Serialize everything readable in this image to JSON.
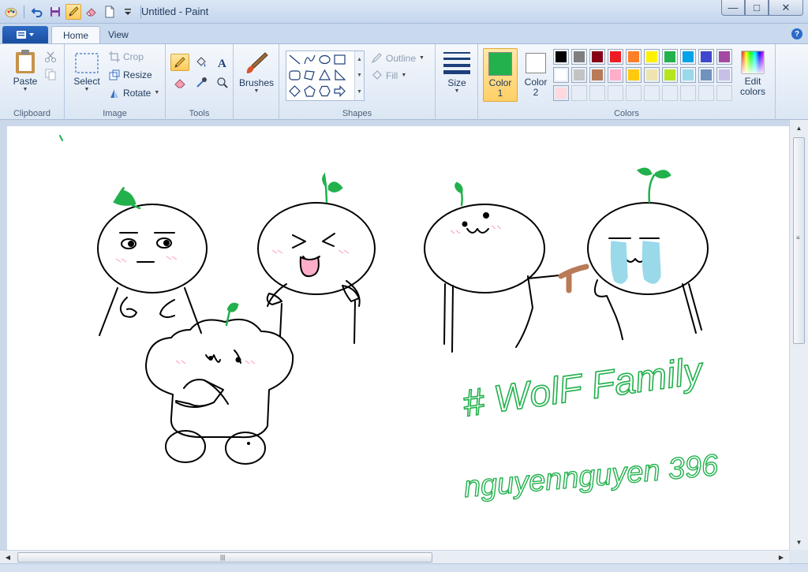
{
  "window": {
    "title": "Untitled - Paint",
    "controls": {
      "minimize": "—",
      "maximize": "□",
      "close": "✕"
    }
  },
  "tabs": [
    {
      "label": "Home",
      "active": true
    },
    {
      "label": "View",
      "active": false
    }
  ],
  "help": "?",
  "ribbon": {
    "clipboard": {
      "group_label": "Clipboard",
      "paste": "Paste"
    },
    "image": {
      "group_label": "Image",
      "select": "Select",
      "crop": "Crop",
      "resize": "Resize",
      "rotate": "Rotate"
    },
    "tools": {
      "group_label": "Tools",
      "active_tool": "pencil"
    },
    "brushes": {
      "label": "Brushes"
    },
    "shapes": {
      "group_label": "Shapes",
      "outline": "Outline",
      "fill": "Fill"
    },
    "size": {
      "label": "Size"
    },
    "colors": {
      "group_label": "Colors",
      "color1_label": "Color",
      "color1_num": "1",
      "color1_value": "#22b14c",
      "color2_label": "Color",
      "color2_num": "2",
      "color2_value": "#ffffff",
      "edit_line1": "Edit",
      "edit_line2": "colors",
      "palette": [
        "#000000",
        "#7f7f7f",
        "#880015",
        "#ed1c24",
        "#ff7f27",
        "#fff200",
        "#22b14c",
        "#00a2e8",
        "#3f48cc",
        "#a349a4",
        "#ffffff",
        "#c3c3c3",
        "#b97a57",
        "#ffaec9",
        "#ffc90e",
        "#efe4b0",
        "#b5e61d",
        "#99d9ea",
        "#7092be",
        "#c8bfe7",
        "#ffd8e0",
        "",
        "",
        "",
        "",
        "",
        "",
        "",
        "",
        ""
      ]
    }
  },
  "canvas": {
    "text_line1": "# WolF Family",
    "text_line2": "nguyennguyen 396",
    "ink_color": "#000000",
    "green_color": "#22b14c",
    "blush_color": "#ffaec9",
    "tear_color": "#99d9ea",
    "stick_color": "#b97a57"
  },
  "scroll": {
    "grip": "|||",
    "grip_v": "≡"
  }
}
